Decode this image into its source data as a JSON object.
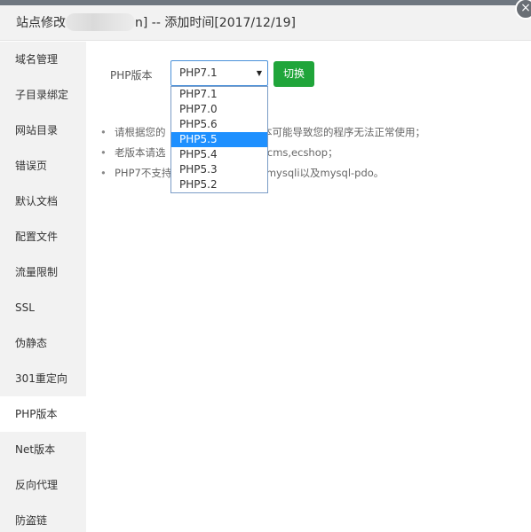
{
  "dialog": {
    "title_prefix": "站点修改",
    "title_suffix": "n] -- 添加时间[2017/12/19]",
    "close_label": "×"
  },
  "sidebar": {
    "items": [
      {
        "label": "域名管理"
      },
      {
        "label": "子目录绑定"
      },
      {
        "label": "网站目录"
      },
      {
        "label": "错误页"
      },
      {
        "label": "默认文档"
      },
      {
        "label": "配置文件"
      },
      {
        "label": "流量限制"
      },
      {
        "label": "SSL"
      },
      {
        "label": "伪静态"
      },
      {
        "label": "301重定向"
      },
      {
        "label": "PHP版本"
      },
      {
        "label": "Net版本"
      },
      {
        "label": "反向代理"
      },
      {
        "label": "防盗链"
      }
    ],
    "active": "PHP版本"
  },
  "php": {
    "label": "PHP版本",
    "selected_value": "PHP7.1",
    "arrow": "▼",
    "switch_label": "切换",
    "options": [
      "PHP7.1",
      "PHP7.0",
      "PHP5.6",
      "PHP5.5",
      "PHP5.4",
      "PHP5.3",
      "PHP5.2"
    ],
    "highlighted": "PHP5.5"
  },
  "tips": [
    "请根据您的",
    "老版本请选",
    "PHP7不支持"
  ],
  "tips_tail": [
    "切换版本可能导致您的程序无法正常使用；",
    "decms,ecshop；",
    "装mysqli以及mysql-pdo。"
  ]
}
